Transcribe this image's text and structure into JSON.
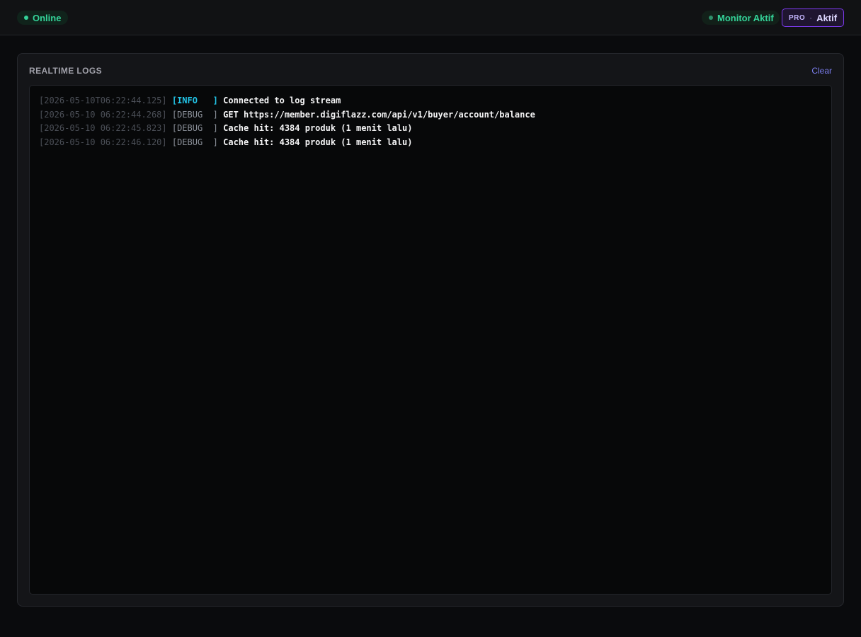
{
  "header": {
    "status": {
      "label": "Online",
      "color": "#34d399"
    },
    "monitor": {
      "label": "Monitor Aktif",
      "color": "#34d399"
    },
    "plan": {
      "tier": "PRO",
      "separator": "·",
      "status": "Aktif",
      "accent": "#7c3aed"
    }
  },
  "logs_panel": {
    "title": "REALTIME LOGS",
    "clear_label": "Clear",
    "entries": [
      {
        "timestamp": "[2026-05-10T06:22:44.125]",
        "level": "[INFO   ]",
        "level_type": "info",
        "message": "Connected to log stream"
      },
      {
        "timestamp": "[2026-05-10 06:22:44.268]",
        "level": "[DEBUG  ]",
        "level_type": "debug",
        "message": "GET https://member.digiflazz.com/api/v1/buyer/account/balance"
      },
      {
        "timestamp": "[2026-05-10 06:22:45.823]",
        "level": "[DEBUG  ]",
        "level_type": "debug",
        "message": "Cache hit: 4384 produk (1 menit lalu)"
      },
      {
        "timestamp": "[2026-05-10 06:22:46.120]",
        "level": "[DEBUG  ]",
        "level_type": "debug",
        "message": "Cache hit: 4384 produk (1 menit lalu)"
      }
    ]
  },
  "colors": {
    "background": "#0a0b0d",
    "info": "#22c3e6",
    "debug": "#8a8f98",
    "link": "#7c7ff0"
  }
}
